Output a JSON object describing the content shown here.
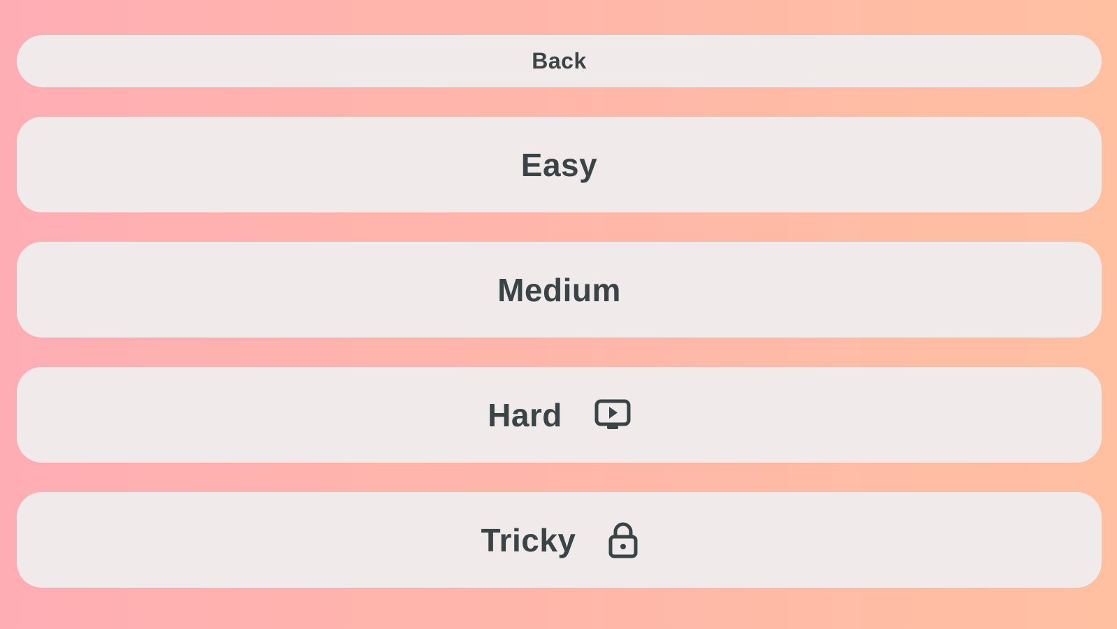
{
  "back_button": {
    "label": "Back"
  },
  "levels": [
    {
      "label": "Easy",
      "icon": null
    },
    {
      "label": "Medium",
      "icon": null
    },
    {
      "label": "Hard",
      "icon": "video-ad-icon"
    },
    {
      "label": "Tricky",
      "icon": "lock-icon"
    }
  ],
  "colors": {
    "button_bg": "#f0ebea",
    "text": "#3a4447",
    "gradient_left": "#ffadb4",
    "gradient_right": "#ffc0a2"
  }
}
